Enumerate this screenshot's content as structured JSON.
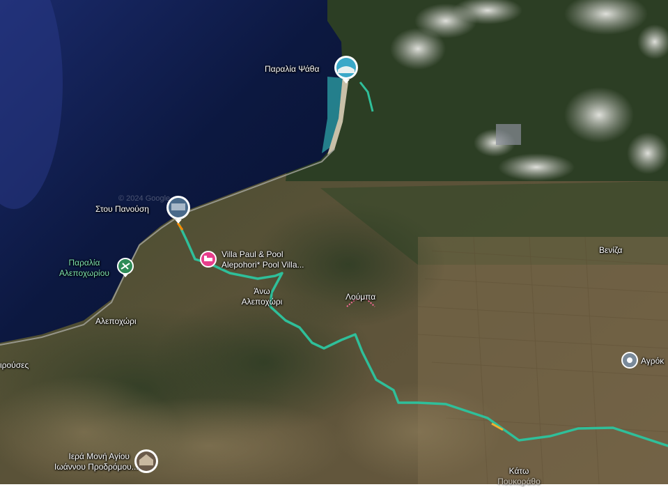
{
  "map": {
    "type": "satellite",
    "labels": {
      "psatha": "Παραλία Ψάθα",
      "panousi": "Στου Πανούση",
      "villa_line1": "Villa Paul & Pool",
      "villa_line2": "Alepohori* Pool Villa...",
      "beach_line1": "Παραλία",
      "beach_line2": "Αλεποχωρίου",
      "ano_line1": "Άνω",
      "ano_line2": "Αλεποχώρι",
      "loumpa": "Λούμπα",
      "veniza": "Βενίζα",
      "alepochori": "Αλεποχώρι",
      "pirouses": "ιρούσες",
      "agrok": "Αγρόκ",
      "moni_line1": "Ιερά Μονή Αγίου",
      "moni_line2": "Ιωάννου Προδρόμου...",
      "kato_line1": "Κάτω",
      "kato_line2": "Πουκοράθο"
    },
    "colors": {
      "sea": "#0d1a3a",
      "route": "#2fbf9a",
      "hotel_pin": "#e83e8c",
      "beach_pin": "#2e8b57"
    },
    "icons": {
      "hotel": "bed-icon",
      "beach": "beach-umbrella-icon",
      "poi": "location-pin-icon"
    }
  }
}
